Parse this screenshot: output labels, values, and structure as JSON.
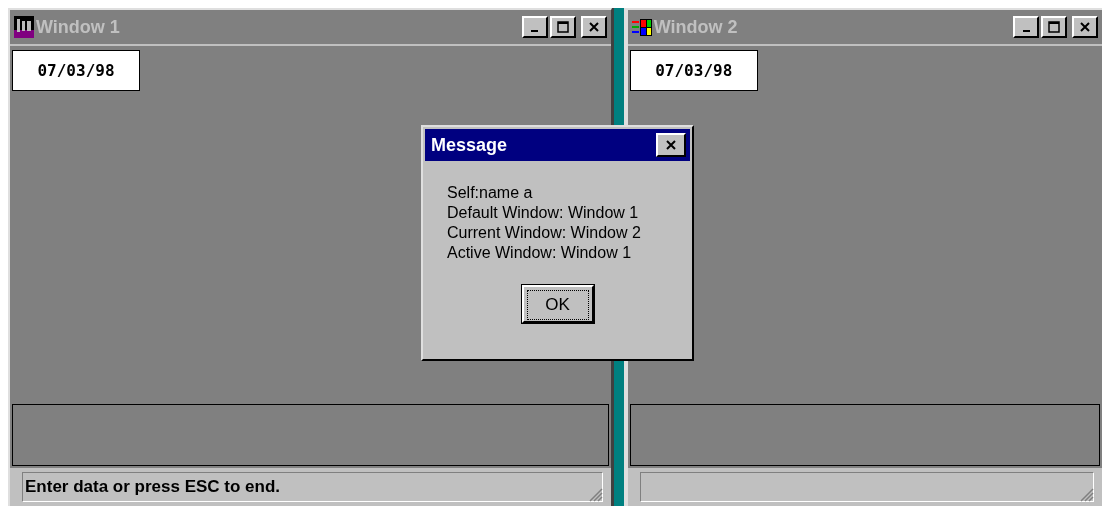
{
  "windows": [
    {
      "title": "Window 1",
      "kind": "app",
      "date": "07/03/98",
      "status": "Enter data or press ESC to end."
    },
    {
      "title": "Window 2",
      "kind": "flag",
      "date": "07/03/98"
    }
  ],
  "dialog": {
    "title": "Message",
    "lines": [
      "Self:name a",
      "Default Window: Window 1",
      "Current Window: Window 2",
      "Active Window: Window 1"
    ],
    "button": "OK"
  }
}
